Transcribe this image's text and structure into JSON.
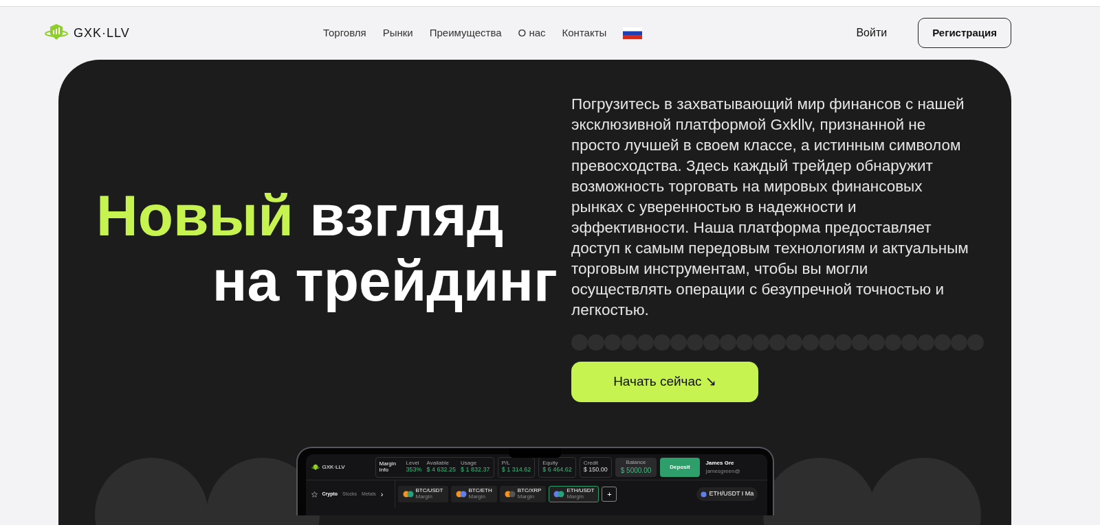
{
  "header": {
    "brand": "GXK·LLV",
    "nav": [
      "Торговля",
      "Рынки",
      "Преимущества",
      "О нас",
      "Контакты"
    ],
    "login": "Войти",
    "register": "Регистрация"
  },
  "hero": {
    "headline": [
      [
        {
          "text": "Новый",
          "accent": true
        },
        {
          "text": "взгляд",
          "accent": false
        }
      ],
      [
        {
          "text": "на",
          "accent": false
        },
        {
          "text": "трейдинг",
          "accent": false
        }
      ]
    ],
    "description": "Погрузитесь в захватывающий мир финансов с нашей эксклюзивной платформой Gxkllv, признанной не просто лучшей в своем классе, а истинным символом превосходства. Здесь каждый трейдер обнаружит возможность торговать на мировых финансовых рынках с уверенностью в надежности и эффективности. Наша платформа предоставляет доступ к самым передовым технологиям и актуальным торговым инструментам, чтобы вы могли осуществлять операции с безупречной точностью и легкостью.",
    "cta": "Начать сейчас ↘"
  },
  "mockup": {
    "brand": "GXK·LLV",
    "stat_groups": [
      {
        "title": "Margin Info",
        "stats": [
          {
            "label": "Level",
            "value": "353%",
            "positive": true
          },
          {
            "label": "Available",
            "value": "$ 4 632.25",
            "positive": true
          },
          {
            "label": "Usage",
            "value": "$ 1 832.37",
            "positive": true
          }
        ]
      },
      {
        "stats": [
          {
            "label": "P/L",
            "value": "$ 1 314.62",
            "positive": true
          }
        ]
      },
      {
        "stats": [
          {
            "label": "Equity",
            "value": "$ 6 464.62",
            "positive": true
          }
        ]
      },
      {
        "stats": [
          {
            "label": "Credit",
            "value": "$ 150.00",
            "positive": false
          }
        ]
      }
    ],
    "balance": {
      "label": "Balance",
      "value": "$ 5000.00"
    },
    "deposit": "Deposit",
    "user": {
      "name": "James Gre",
      "email": "jamesgreen@"
    },
    "tabs": [
      {
        "label": "Crypto",
        "selected": true
      },
      {
        "label": "Stocks",
        "selected": false
      },
      {
        "label": "Metals",
        "selected": false
      }
    ],
    "more": "›",
    "pairs": [
      {
        "name": "BTC/USDT",
        "sub": "Margin",
        "selected": false
      },
      {
        "name": "BTC/ETH",
        "sub": "Margin",
        "selected": false
      },
      {
        "name": "BTC/XRP",
        "sub": "Margin",
        "selected": false
      },
      {
        "name": "ETH/USDT",
        "sub": "Margin",
        "selected": true
      }
    ],
    "add": "+",
    "ticker": "ETH/USDT I Ma"
  }
}
